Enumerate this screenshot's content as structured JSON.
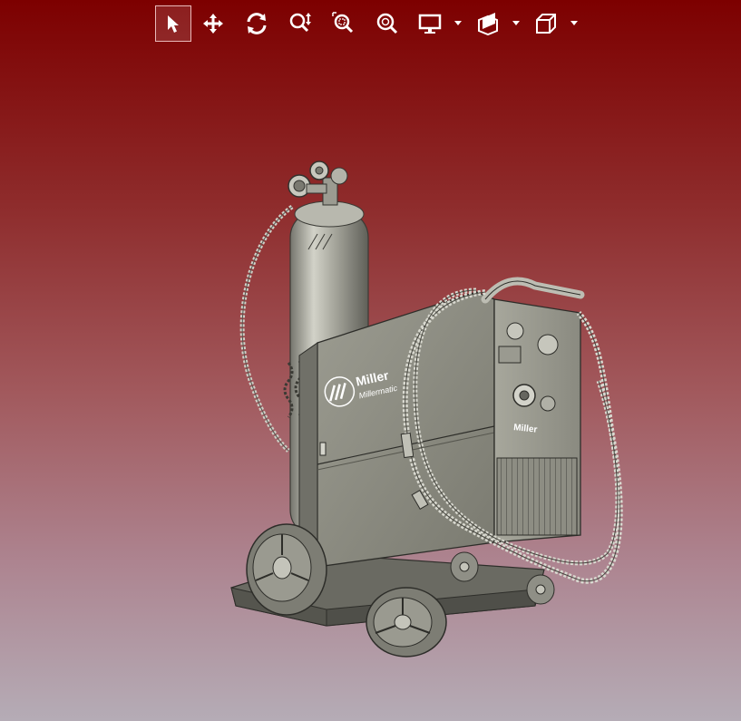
{
  "toolbar": {
    "tools": [
      {
        "icon": "select-arrow-icon",
        "active": true
      },
      {
        "icon": "pan-move-icon",
        "active": false
      },
      {
        "icon": "rotate-icon",
        "active": false
      },
      {
        "icon": "zoom-vertical-icon",
        "active": false
      },
      {
        "icon": "zoom-window-icon",
        "active": false
      },
      {
        "icon": "zoom-fit-icon",
        "active": false
      },
      {
        "icon": "display-mode-icon",
        "dropdown": true
      },
      {
        "icon": "section-plane-icon",
        "dropdown": true
      },
      {
        "icon": "view-cube-icon",
        "dropdown": true
      }
    ]
  },
  "model": {
    "brand": "Miller",
    "model_name": "Millermatic",
    "panel_brand": "Miller"
  },
  "colors": {
    "background_top": "#7d0000",
    "background_bottom": "#b5acb6",
    "toolbar_icon": "#ffffff",
    "model_body": "#8f8f85"
  }
}
